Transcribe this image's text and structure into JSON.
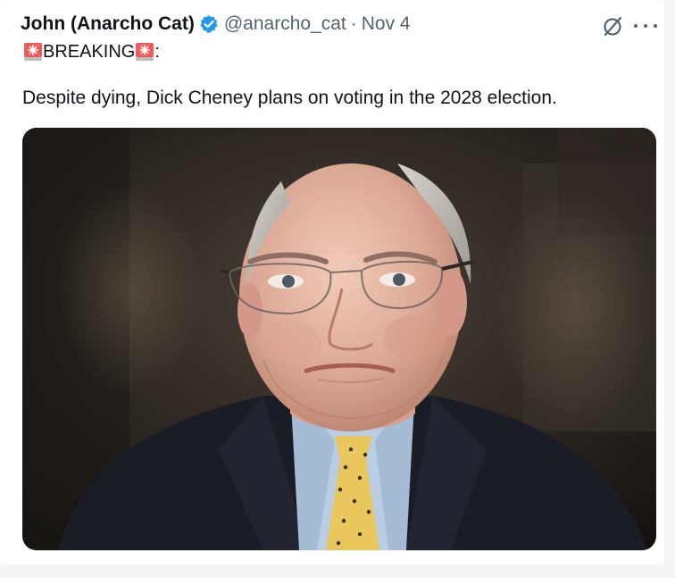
{
  "author": {
    "display_name": "John (Anarcho Cat)",
    "handle": "@anarcho_cat",
    "separator": "·",
    "date": "Nov 4",
    "verified": true,
    "verified_color": "#1d9bf0"
  },
  "icons": {
    "verified": "verified-badge-icon",
    "grok": "grok-slash-circle-icon",
    "more": "more-horizontal-icon",
    "siren": "police-siren-emoji-icon"
  },
  "tweet": {
    "breaking_label": "BREAKING",
    "breaking_suffix": ":",
    "text": "Despite dying, Dick Cheney plans on voting in the 2028 election."
  },
  "colors": {
    "text_primary": "#0f1419",
    "text_secondary": "#536471",
    "background": "#ffffff"
  }
}
